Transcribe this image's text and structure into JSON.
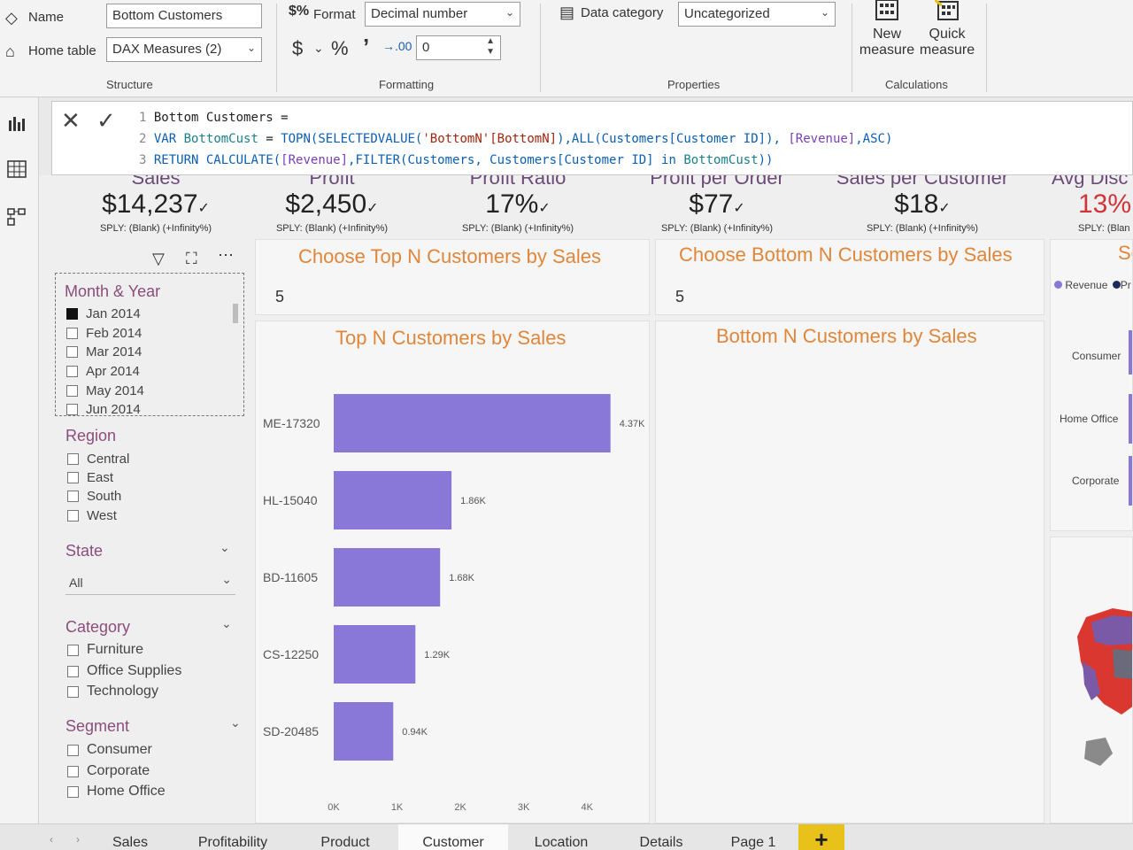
{
  "ribbon": {
    "name_label": "Name",
    "name_value": "Bottom Customers",
    "home_table_label": "Home table",
    "home_table_value": "DAX Measures (2)",
    "structure_label": "Structure",
    "format_label": "Format",
    "format_value": "Decimal number",
    "currency_symbol": "$",
    "percent_symbol": "%",
    "comma_symbol": "’",
    "decimals_value": "0",
    "formatting_label": "Formatting",
    "data_category_label": "Data category",
    "data_category_value": "Uncategorized",
    "properties_label": "Properties",
    "new_measure_line1": "New",
    "new_measure_line2": "measure",
    "quick_measure_line1": "Quick",
    "quick_measure_line2": "measure",
    "calculations_label": "Calculations"
  },
  "formula": {
    "line_numbers": [
      "1",
      "2",
      "3"
    ],
    "line1": "Bottom Customers =",
    "line2_var": "VAR",
    "line2_name": "BottomCust",
    "line2_rest": " = ",
    "line2_topn": "TOPN(SELECTEDVALUE(",
    "line2_str": "'BottomN'[BottomN]",
    "line2_mid": "),ALL(Customers[Customer ID]), ",
    "line2_meas": "[Revenue]",
    "line2_end": ",ASC)",
    "line3_return": "RETURN",
    "line3_calc": " CALCULATE(",
    "line3_meas": "[Revenue]",
    "line3_mid": ",FILTER(Customers, Customers[Customer ID] ",
    "line3_in": "in",
    "line3_var": " BottomCust",
    "line3_end": "))"
  },
  "kpis": [
    {
      "title": "Sales",
      "value": "$14,237",
      "sub": "SPLY: (Blank) (+Infinity%)"
    },
    {
      "title": "Profit",
      "value": "$2,450",
      "sub": "SPLY: (Blank) (+Infinity%)"
    },
    {
      "title": "Profit Ratio",
      "value": "17%",
      "sub": "SPLY: (Blank) (+Infinity%)"
    },
    {
      "title": "Profit per Order",
      "value": "$77",
      "sub": "SPLY: (Blank) (+Infinity%)"
    },
    {
      "title": "Sales per Customer",
      "value": "$18",
      "sub": "SPLY: (Blank) (+Infinity%)"
    },
    {
      "title": "Avg Disc",
      "value": "13%",
      "sub": "SPLY: (Blan"
    }
  ],
  "slicers": {
    "month_title": "Month & Year",
    "months": [
      "Jan 2014",
      "Feb 2014",
      "Mar 2014",
      "Apr 2014",
      "May 2014",
      "Jun 2014"
    ],
    "region_title": "Region",
    "regions": [
      "Central",
      "East",
      "South",
      "West"
    ],
    "state_title": "State",
    "state_value": "All",
    "category_title": "Category",
    "categories": [
      "Furniture",
      "Office Supplies",
      "Technology"
    ],
    "segment_title": "Segment",
    "segments": [
      "Consumer",
      "Corporate",
      "Home Office"
    ]
  },
  "visuals": {
    "top_n_title": "Choose Top N Customers by Sales",
    "top_n_value": "5",
    "bottom_n_title": "Choose Bottom N Customers by Sales",
    "bottom_n_value": "5",
    "top_chart_title": "Top N Customers by Sales",
    "bottom_chart_title": "Bottom N Customers by Sales",
    "right_title_partial": "Se",
    "legend_revenue": "Revenue",
    "legend_partial": "Pr",
    "segment_labels": [
      "Consumer",
      "Home Office",
      "Corporate"
    ]
  },
  "chart_data": {
    "type": "bar",
    "orientation": "horizontal",
    "title": "Top N Customers by Sales",
    "categories": [
      "ME-17320",
      "HL-15040",
      "BD-11605",
      "CS-12250",
      "SD-20485"
    ],
    "values": [
      4370,
      1860,
      1680,
      1290,
      940
    ],
    "data_labels": [
      "4.37K",
      "1.86K",
      "1.68K",
      "1.29K",
      "0.94K"
    ],
    "x_ticks": [
      "0K",
      "1K",
      "2K",
      "3K",
      "4K"
    ],
    "xlim": [
      0,
      4500
    ],
    "bar_color": "#8a78d8"
  },
  "tabs": [
    "Sales",
    "Profitability",
    "Product",
    "Customer",
    "Location",
    "Details",
    "Page 1"
  ],
  "active_tab": "Customer",
  "colors": {
    "accent_orange": "#e0863a",
    "slicer_title": "#8b4d7b",
    "bar": "#8a78d8",
    "add_tab": "#e8c21b",
    "kpi_red": "#d0343a"
  }
}
